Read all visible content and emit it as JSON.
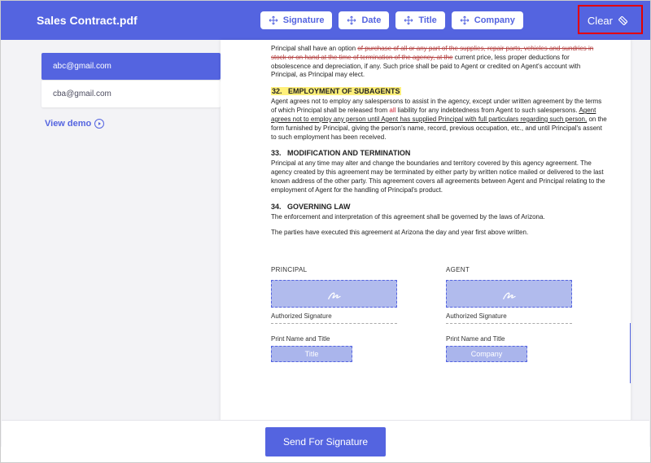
{
  "header": {
    "filename": "Sales Contract.pdf",
    "tools": [
      "Signature",
      "Date",
      "Title",
      "Company"
    ],
    "clear": "Clear"
  },
  "sidebar": {
    "contacts": [
      "abc@gmail.com",
      "cba@gmail.com"
    ],
    "viewdemo": "View demo"
  },
  "doc": {
    "introFragment": "Principal shall have an option of purchase of all or any part of the supplies, repair parts, vehicles and sundries in stock or on hand at the time of termination of the agency, at the current price, less proper deductions for obsolescence and depreciation, if any. Such price shall be paid to Agent or credited on Agent's account with Principal, as Principal may elect.",
    "sec32": {
      "num": "32.",
      "title": "EMPLOYMENT OF SUBAGENTS",
      "body": "Agent agrees not to employ any salespersons to assist in the agency, except under written agreement by the terms of which Principal shall be released from all liability for any indebtedness from Agent to such salespersons. Agent agrees not to employ any person until Agent has supplied Principal with full particulars regarding such person, on the form furnished by Principal, giving the person's name, record, previous occupation, etc., and until Principal's assent to such employment has been received."
    },
    "sec33": {
      "num": "33.",
      "title": "MODIFICATION AND TERMINATION",
      "body": "Principal at any time may alter and change the boundaries and territory covered by this agency agreement. The agency created by this agreement may be terminated by either party by written notice mailed or delivered to the last known address of the other party. This agreement covers all agreements between Agent and Principal relating to the employment of Agent for the handling of Principal's product."
    },
    "sec34": {
      "num": "34.",
      "title": "GOVERNING LAW",
      "body1": "The enforcement and interpretation of this agreement shall be governed by the laws of Arizona.",
      "body2": "The parties have executed this agreement at Arizona the day and year first above written."
    },
    "sig": {
      "principal": "PRINCIPAL",
      "agent": "AGENT",
      "authorized": "Authorized Signature",
      "printname": "Print Name and Title",
      "tags": {
        "title": "Title",
        "company": "Company"
      }
    }
  },
  "footer": {
    "send": "Send For Signature"
  }
}
